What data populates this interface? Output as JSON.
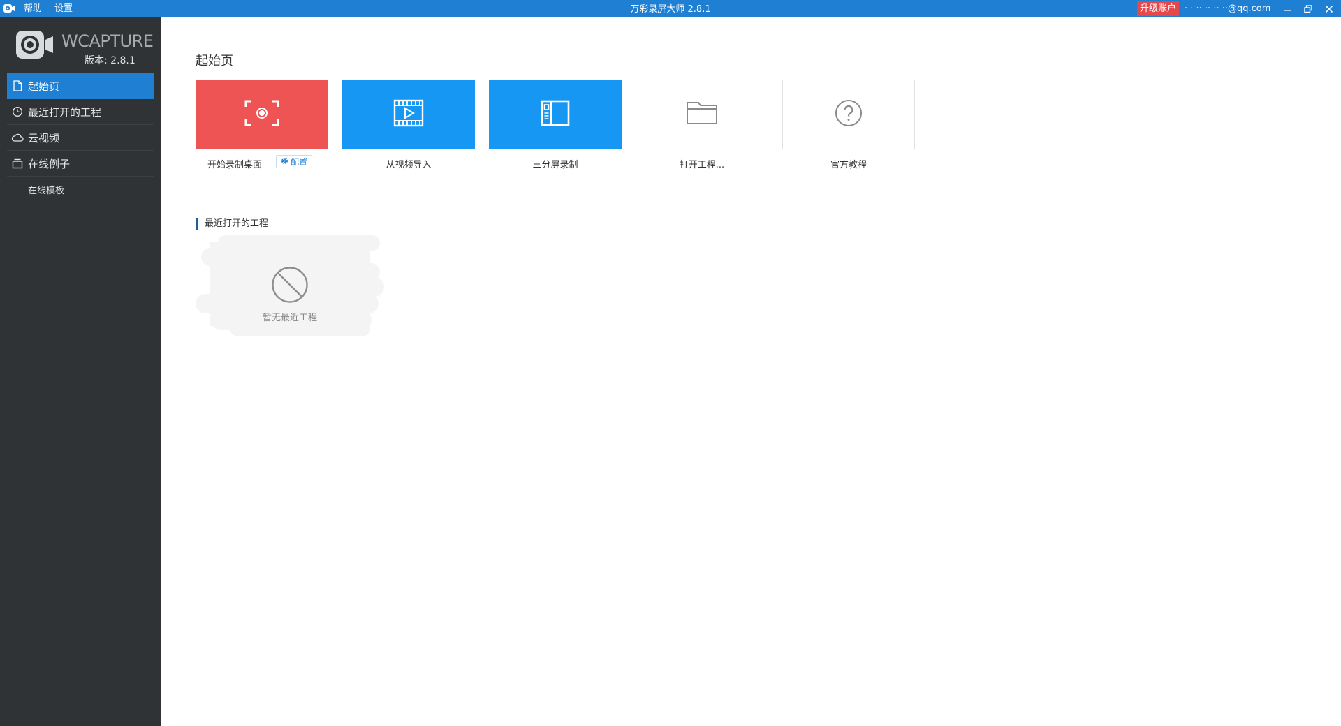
{
  "titlebar": {
    "menu": [
      "帮助",
      "设置"
    ],
    "title": "万彩录屏大师 2.8.1",
    "upgrade_label": "升级账户",
    "account": "· · ·· ·· ·· ··@qq.com",
    "colors": {
      "bar": "#1f7fd3",
      "upgrade": "#e6474b"
    }
  },
  "sidebar": {
    "logo_text": "WCAPTURE",
    "version": "版本: 2.8.1",
    "items": [
      {
        "label": "起始页",
        "icon": "document-icon",
        "active": true
      },
      {
        "label": "最近打开的工程",
        "icon": "clock-icon",
        "active": false
      },
      {
        "label": "云视频",
        "icon": "cloud-icon",
        "active": false
      },
      {
        "label": "在线例子",
        "icon": "window-icon",
        "active": false
      },
      {
        "label": "在线模板",
        "icon": "",
        "active": false
      }
    ]
  },
  "main": {
    "title": "起始页",
    "tiles": [
      {
        "label": "开始录制桌面",
        "icon": "record-screen-icon",
        "color": "#ef5454"
      },
      {
        "label": "从视频导入",
        "icon": "video-import-icon",
        "color": "#1597f3"
      },
      {
        "label": "三分屏录制",
        "icon": "split-screen-icon",
        "color": "#1597f3"
      },
      {
        "label": "打开工程...",
        "icon": "folder-icon",
        "color": "#ffffff"
      },
      {
        "label": "官方教程",
        "icon": "help-icon",
        "color": "#ffffff"
      }
    ],
    "config_label": "配置",
    "recent_title": "最近打开的工程",
    "empty_text": "暂无最近工程"
  }
}
